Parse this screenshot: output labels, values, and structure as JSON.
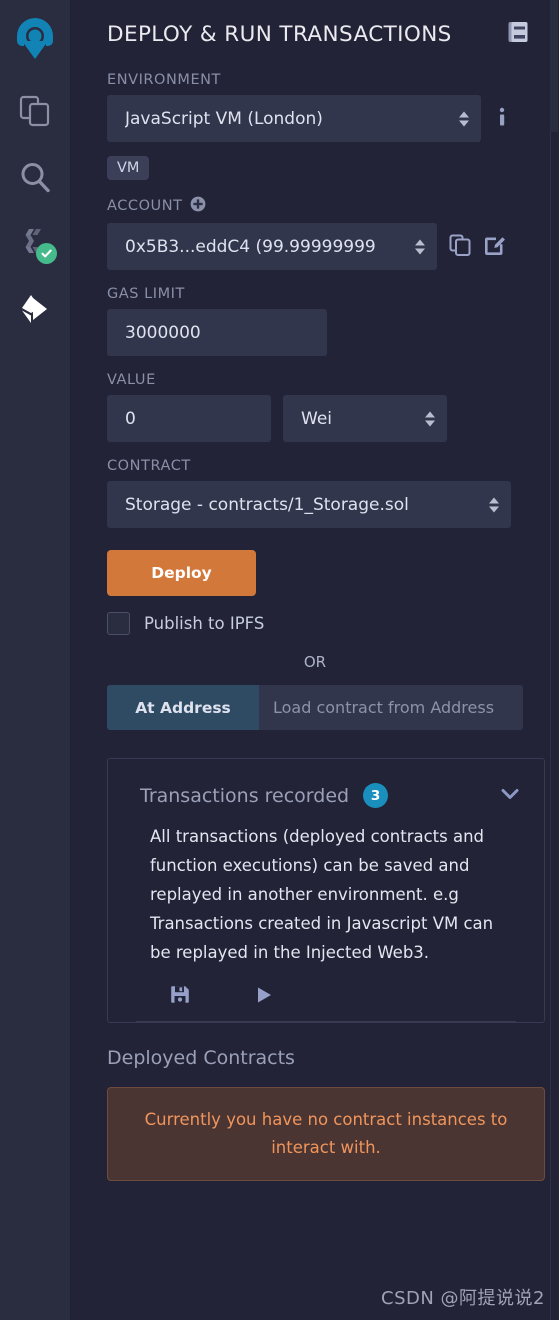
{
  "sidebar": {
    "items": [
      {
        "name": "remix-logo",
        "label": "Remix Home"
      },
      {
        "name": "file-explorer",
        "label": "File Explorers"
      },
      {
        "name": "search",
        "label": "Search in files"
      },
      {
        "name": "solidity-compiler",
        "label": "Solidity Compiler",
        "status": "success"
      },
      {
        "name": "deploy-run",
        "label": "Deploy & Run Transactions",
        "active": true
      }
    ]
  },
  "header": {
    "title": "DEPLOY & RUN TRANSACTIONS",
    "doc_icon": "book-icon"
  },
  "form": {
    "environment_label": "ENVIRONMENT",
    "environment_value": "JavaScript VM (London)",
    "environment_info_icon": "info-icon",
    "vm_badge": "VM",
    "account_label": "ACCOUNT",
    "account_add_icon": "plus-circle-icon",
    "account_value": "0x5B3...eddC4 (99.99999999",
    "account_copy_icon": "copy-icon",
    "account_edit_icon": "edit-icon",
    "gas_limit_label": "GAS LIMIT",
    "gas_limit_value": "3000000",
    "value_label": "VALUE",
    "value_amount": "0",
    "value_unit": "Wei",
    "contract_label": "CONTRACT",
    "contract_value": "Storage - contracts/1_Storage.sol",
    "deploy_button": "Deploy",
    "publish_ipfs_label": "Publish to IPFS",
    "publish_ipfs_checked": false,
    "or_text": "OR",
    "at_address_button": "At Address",
    "at_address_placeholder": "Load contract from Address"
  },
  "recorded": {
    "title": "Transactions recorded",
    "count": "3",
    "chevron_icon": "chevron-down-icon",
    "description": "All transactions (deployed contracts and function executions) can be saved and replayed in another environment. e.g Transactions created in Javascript VM can be replayed in the Injected Web3.",
    "save_icon": "save-icon",
    "play_icon": "play-icon"
  },
  "deployed": {
    "title": "Deployed Contracts",
    "empty_message": "Currently you have no contract instances to interact with."
  },
  "watermark": "CSDN @阿提说说2",
  "colors": {
    "panel_bg": "#222336",
    "sidebar_bg": "#2a2c3f",
    "input_bg": "#32364d",
    "deploy_orange": "#d2783a",
    "at_address_blue": "#2f4a63",
    "badge_blue": "#1a8fbe",
    "check_green": "#45ba8b",
    "alert_text": "#f0955c",
    "alert_bg": "#4a3533",
    "logo_blue": "#1183b5"
  }
}
